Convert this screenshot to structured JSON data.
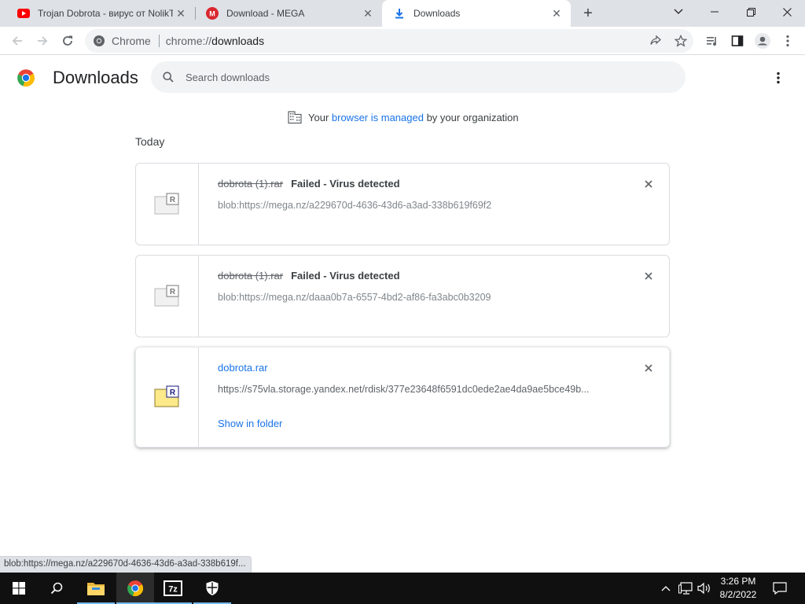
{
  "tabs": [
    {
      "title": "Trojan Dobrota - вирус от NolikTM",
      "favicon": "youtube-icon"
    },
    {
      "title": "Download - MEGA",
      "favicon": "mega-icon"
    },
    {
      "title": "Downloads",
      "favicon": "download-icon",
      "active": true
    }
  ],
  "omnibox": {
    "chip": "Chrome",
    "scheme": "chrome://",
    "host": "downloads"
  },
  "page": {
    "title": "Downloads",
    "search_placeholder": "Search downloads",
    "managed_prefix": "Your ",
    "managed_link": "browser is managed",
    "managed_suffix": " by your organization",
    "section_date": "Today"
  },
  "downloads": [
    {
      "filename": "dobrota (1).rar",
      "status": "Failed - Virus detected",
      "url": "blob:https://mega.nz/a229670d-4636-43d6-a3ad-338b619f69f2"
    },
    {
      "filename": "dobrota (1).rar",
      "status": "Failed - Virus detected",
      "url": "blob:https://mega.nz/daaa0b7a-6557-4bd2-af86-fa3abc0b3209"
    },
    {
      "filename": "dobrota.rar",
      "url": "https://s75vla.storage.yandex.net/rdisk/377e23648f6591dc0ede2ae4da9ae5bce49b...",
      "action": "Show in folder"
    }
  ],
  "statusbar": "blob:https://mega.nz/a229670d-4636-43d6-a3ad-338b619f...",
  "taskbar": {
    "apps": [
      "start-icon",
      "search-icon",
      "file-explorer-icon",
      "chrome-icon",
      "7zip-icon",
      "security-icon"
    ],
    "clock_time": "3:26 PM",
    "clock_date": "8/2/2022"
  },
  "colors": {
    "accent": "#1a73e8",
    "tabstrip": "#dee1e6",
    "taskbar": "#101010"
  }
}
